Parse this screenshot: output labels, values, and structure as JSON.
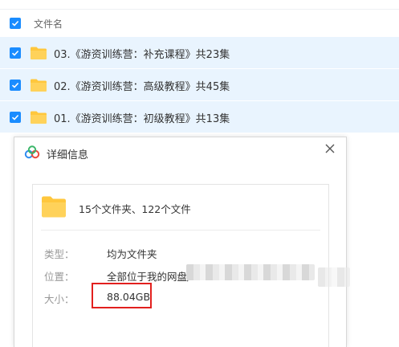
{
  "header": {
    "column_name": "文件名"
  },
  "files": [
    {
      "name": "03.《游资训练营：补充课程》共23集"
    },
    {
      "name": "02.《游资训练营：高级教程》共45集"
    },
    {
      "name": "01.《游资训练营：初级教程》共13集"
    }
  ],
  "dialog": {
    "title": "详细信息",
    "summary": "15个文件夹、122个文件",
    "properties": {
      "type_label": "类型：",
      "type_value": "均为文件夹",
      "location_label": "位置：",
      "location_value": "全部位于我的网盘/",
      "size_label": "大小：",
      "size_value": "88.04GB"
    }
  },
  "colors": {
    "accent": "#1a8cff",
    "row_selected": "#e9f4fe",
    "folder": "#ffc73d",
    "highlight": "#e2201e"
  },
  "icons": [
    "checkbox-checked-icon",
    "folder-icon",
    "cloud-logo-icon",
    "close-icon"
  ]
}
